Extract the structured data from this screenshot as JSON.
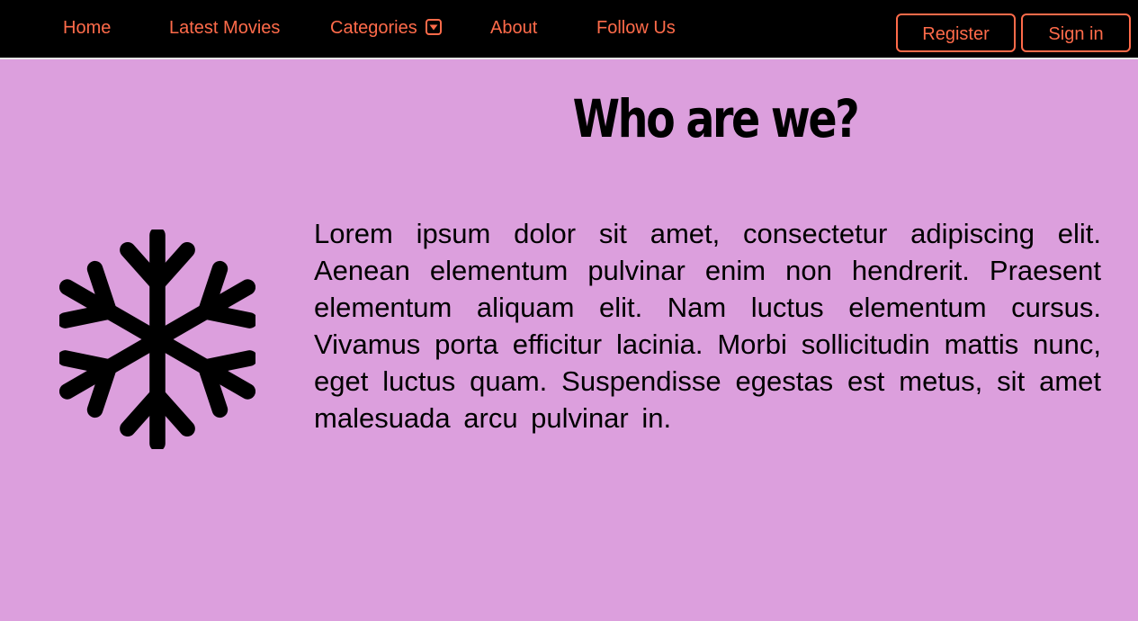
{
  "nav": {
    "items": [
      {
        "label": "Home"
      },
      {
        "label": "Latest Movies"
      },
      {
        "label": "Categories"
      },
      {
        "label": "About"
      },
      {
        "label": "Follow Us"
      }
    ],
    "register_label": "Register",
    "signin_label": "Sign in"
  },
  "main": {
    "title": "Who are we?",
    "paragraph": "Lorem ipsum dolor sit amet, consectetur adipiscing elit. Aenean elementum pulvinar enim non hendrerit. Praesent elementum aliquam elit. Nam luctus elementum cursus. Vivamus porta efficitur lacinia. Morbi sollicitudin mattis nunc, eget luctus quam. Suspendisse egestas est metus, sit amet malesuada arcu pulvinar in."
  },
  "icons": {
    "hero": "snowflake-icon",
    "categories_dropdown": "caret-down-square-icon"
  },
  "colors": {
    "nav_background": "#000000",
    "accent": "#ff6b4a",
    "page_background": "#dc9fdd",
    "text": "#000000"
  }
}
